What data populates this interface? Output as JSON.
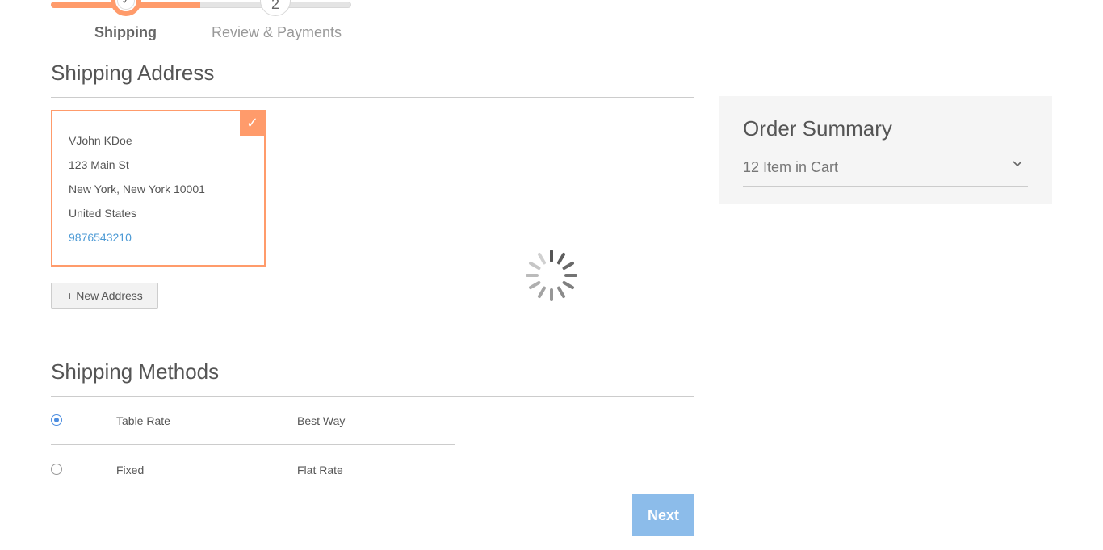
{
  "progress": {
    "step1_label": "Shipping",
    "step1_icon": "check-icon",
    "step2_number": "2",
    "step2_label": "Review & Payments",
    "accent_color": "#ff9b6b"
  },
  "shipping_address": {
    "title": "Shipping Address",
    "card": {
      "name": "VJohn KDoe",
      "street": "123 Main St",
      "city_line": "New York, New York 10001",
      "country": "United States",
      "phone": "9876543210",
      "selected_icon": "check-icon"
    },
    "new_address_label": "+ New Address"
  },
  "loading": {
    "icon": "spinner-icon"
  },
  "order_summary": {
    "title": "Order Summary",
    "cart_label": "12 Item in Cart",
    "chevron_icon": "chevron-down-icon"
  },
  "shipping_methods": {
    "title": "Shipping Methods",
    "rows": [
      {
        "method": "Table Rate",
        "carrier": "Best Way",
        "selected": true
      },
      {
        "method": "Fixed",
        "carrier": "Flat Rate",
        "selected": false
      }
    ]
  },
  "next_label": "Next",
  "colors": {
    "link": "#4c9ad5",
    "button": "#8cbcea",
    "radio": "#4c8de0"
  }
}
